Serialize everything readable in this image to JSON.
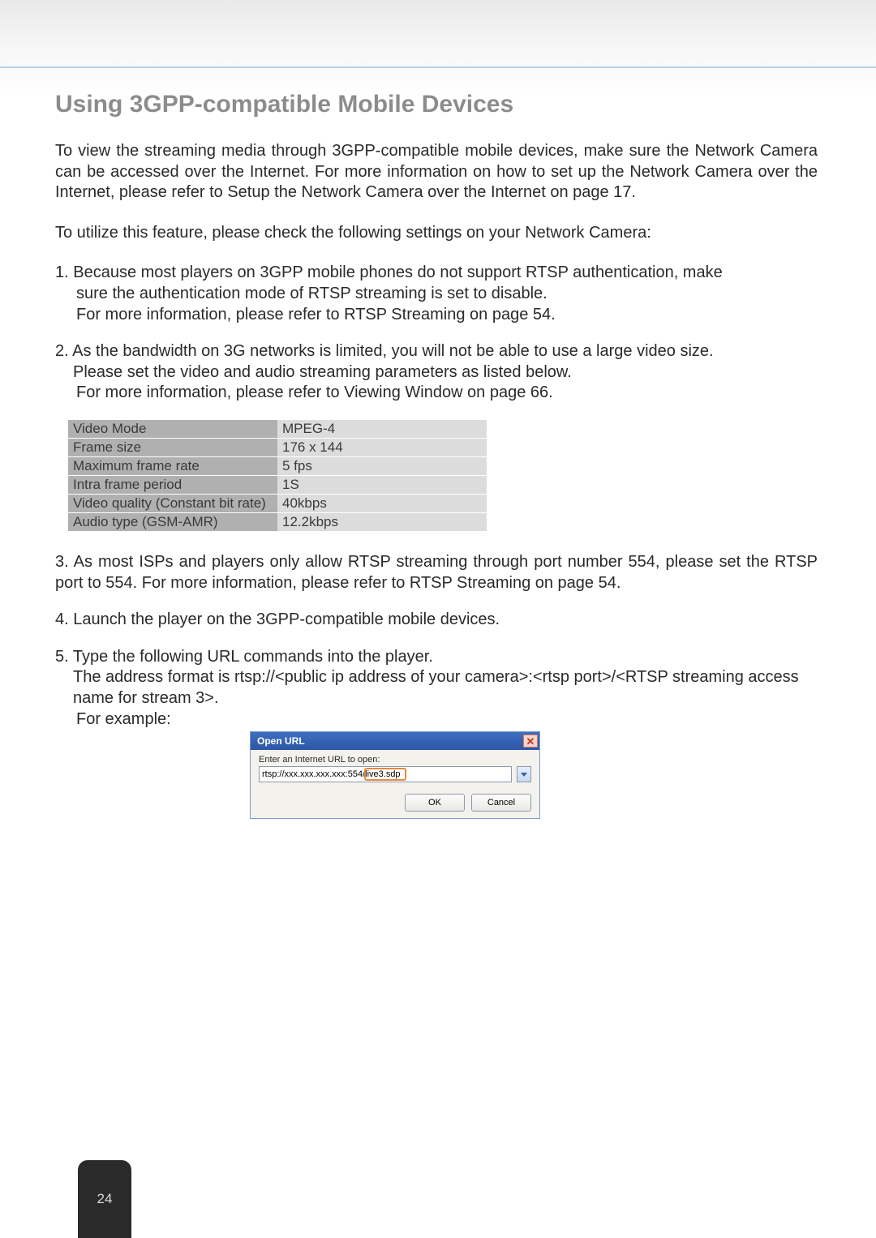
{
  "title": "Using 3GPP-compatible Mobile Devices",
  "intro": "To view the streaming media through 3GPP-compatible mobile devices, make sure the Network Camera can be accessed over the Internet. For more information on how to set up the Network Camera over the Internet, please refer to Setup the Network Camera over the Internet on page 17.",
  "lead": "To utilize this feature, please check the following settings on your Network Camera:",
  "item1_a": "1. Because most players on 3GPP mobile phones do not support RTSP authentication, make",
  "item1_b": "sure the authentication mode of RTSP streaming is set to disable.",
  "item1_c": "For more information, please refer to RTSP Streaming on page 54.",
  "item2_a": "2. As the bandwidth on 3G networks is limited, you will not be able to use a large video size.",
  "item2_b": "Please set the video and audio streaming parameters as listed below.",
  "item2_c": "For more information, please refer to Viewing Window on page 66.",
  "settings": [
    {
      "key": "Video Mode",
      "val": "MPEG-4"
    },
    {
      "key": "Frame size",
      "val": "176 x 144"
    },
    {
      "key": "Maximum frame rate",
      "val": "5 fps"
    },
    {
      "key": "Intra frame period",
      "val": "1S"
    },
    {
      "key": "Video quality (Constant bit rate)",
      "val": "40kbps"
    },
    {
      "key": "Audio type (GSM-AMR)",
      "val": "12.2kbps"
    }
  ],
  "item3": "3. As most ISPs and players only allow RTSP streaming through port number 554, please set the RTSP port to 554. For more information, please refer to RTSP Streaming on page 54.",
  "item4": "4. Launch the player on the 3GPP-compatible mobile devices.",
  "item5_a": "5. Type the following URL commands into the player.",
  "item5_b": "The address format is rtsp://<public ip address of your camera>:<rtsp port>/<RTSP streaming access name for stream 3>.",
  "item5_c": "For example:",
  "dialog": {
    "title": "Open URL",
    "label": "Enter an Internet URL to open:",
    "url": "rtsp://xxx.xxx.xxx.xxx:554/live3.sdp",
    "ok": "OK",
    "cancel": "Cancel"
  },
  "page_number": "24"
}
